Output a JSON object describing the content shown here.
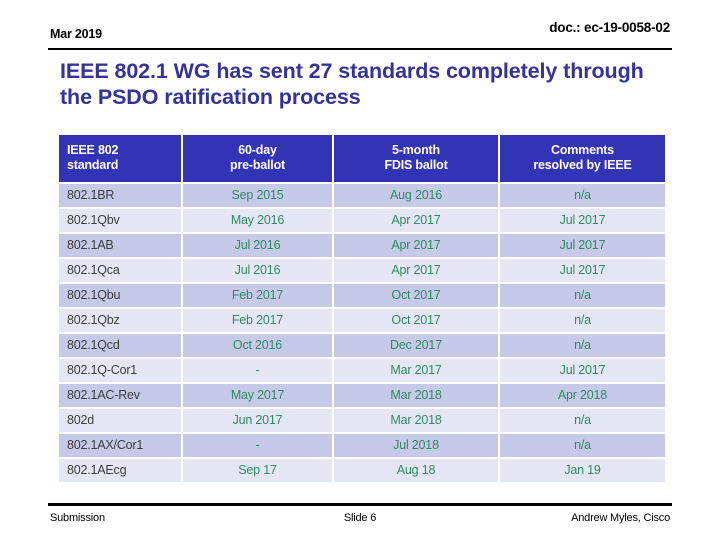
{
  "header": {
    "date": "Mar 2019",
    "doc": "doc.: ec-19-0058-02"
  },
  "title": "IEEE 802.1 WG has sent 27 standards completely through the PSDO ratification process",
  "table": {
    "columns": [
      "IEEE 802 standard",
      "60-day pre-ballot",
      "5-month FDIS ballot",
      "Comments resolved by IEEE"
    ],
    "columns_lines": [
      [
        "IEEE 802",
        "standard"
      ],
      [
        "60-day",
        "pre-ballot"
      ],
      [
        "5-month",
        "FDIS ballot"
      ],
      [
        "Comments",
        "resolved by IEEE"
      ]
    ],
    "rows": [
      {
        "standard": "802.1BR",
        "pre_ballot": "Sep 2015",
        "fdis_ballot": "Aug 2016",
        "comments": "n/a"
      },
      {
        "standard": "802.1Qbv",
        "pre_ballot": "May 2016",
        "fdis_ballot": "Apr 2017",
        "comments": "Jul 2017"
      },
      {
        "standard": "802.1AB",
        "pre_ballot": "Jul 2016",
        "fdis_ballot": "Apr 2017",
        "comments": "Jul 2017"
      },
      {
        "standard": "802.1Qca",
        "pre_ballot": "Jul 2016",
        "fdis_ballot": "Apr 2017",
        "comments": "Jul 2017"
      },
      {
        "standard": "802.1Qbu",
        "pre_ballot": "Feb 2017",
        "fdis_ballot": "Oct 2017",
        "comments": "n/a"
      },
      {
        "standard": "802.1Qbz",
        "pre_ballot": "Feb 2017",
        "fdis_ballot": "Oct 2017",
        "comments": "n/a"
      },
      {
        "standard": "802.1Qcd",
        "pre_ballot": "Oct 2016",
        "fdis_ballot": "Dec 2017",
        "comments": "n/a"
      },
      {
        "standard": "802.1Q-Cor1",
        "pre_ballot": "-",
        "fdis_ballot": "Mar 2017",
        "comments": "Jul 2017"
      },
      {
        "standard": "802.1AC-Rev",
        "pre_ballot": "May 2017",
        "fdis_ballot": "Mar 2018",
        "comments": "Apr 2018"
      },
      {
        "standard": "802d",
        "pre_ballot": "Jun 2017",
        "fdis_ballot": "Mar 2018",
        "comments": "n/a"
      },
      {
        "standard": "802.1AX/Cor1",
        "pre_ballot": "-",
        "fdis_ballot": "Jul 2018",
        "comments": "n/a"
      },
      {
        "standard": "802.1AEcg",
        "pre_ballot": "Sep 17",
        "fdis_ballot": "Aug 18",
        "comments": "Jan 19"
      }
    ]
  },
  "footer": {
    "left": "Submission",
    "center": "Slide 6",
    "right": "Andrew Myles, Cisco"
  },
  "colors": {
    "title": "#333399",
    "header_bg": "#3333b5",
    "header_text": "#ffffff",
    "row_odd": "#c6c9e8",
    "row_even": "#e5e6f4",
    "data_text": "#2e8b63",
    "standard_text": "#3d3d3d"
  }
}
